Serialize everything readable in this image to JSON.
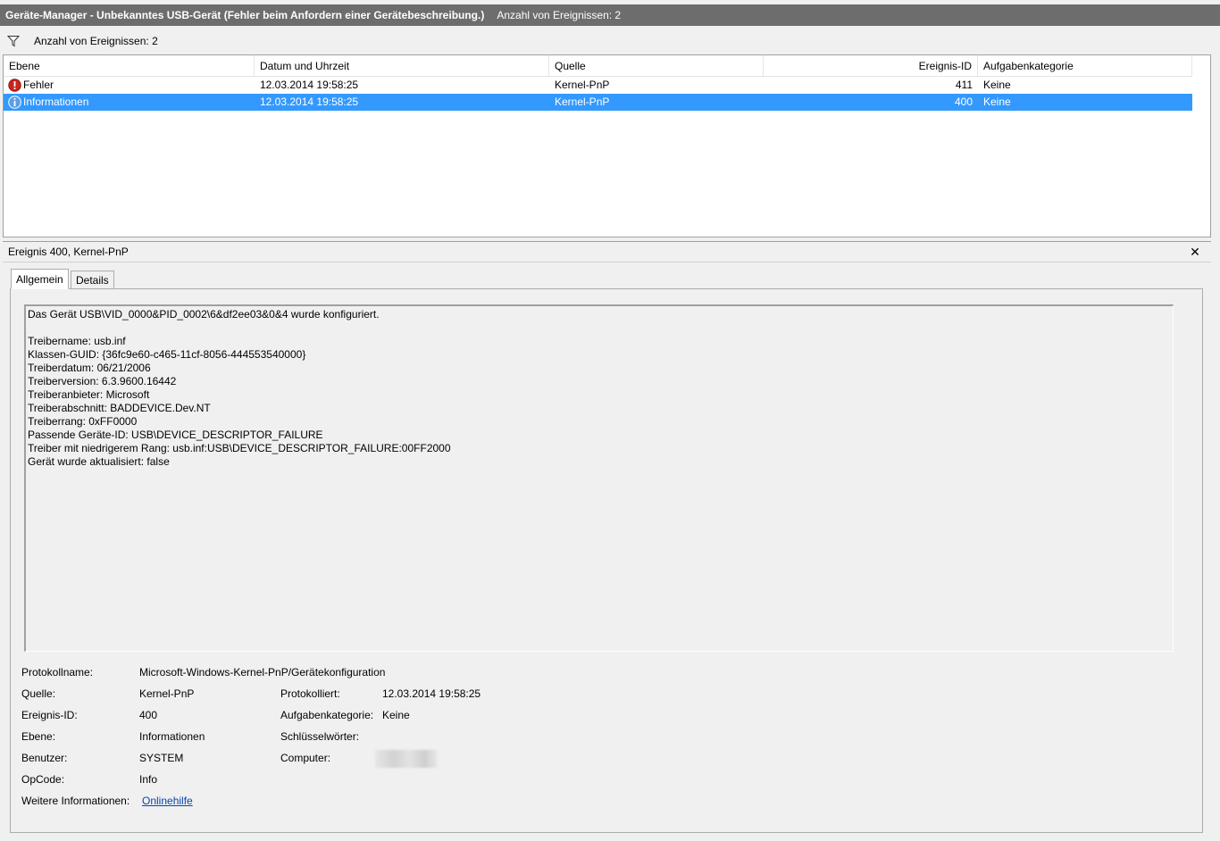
{
  "window": {
    "title": "Geräte-Manager - Unbekanntes USB-Gerät (Fehler beim Anfordern einer Gerätebeschreibung.)",
    "event_count": "Anzahl von Ereignissen: 2"
  },
  "filter_bar": {
    "text": "Anzahl von Ereignissen: 2"
  },
  "grid": {
    "columns": [
      "Ebene",
      "Datum und Uhrzeit",
      "Quelle",
      "Ereignis-ID",
      "Aufgabenkategorie"
    ],
    "rows": [
      {
        "level": "Fehler",
        "level_icon": "error-icon",
        "datetime": "12.03.2014 19:58:25",
        "source": "Kernel-PnP",
        "event_id": "411",
        "category": "Keine",
        "selected": false
      },
      {
        "level": "Informationen",
        "level_icon": "info-icon",
        "datetime": "12.03.2014 19:58:25",
        "source": "Kernel-PnP",
        "event_id": "400",
        "category": "Keine",
        "selected": true
      }
    ]
  },
  "detail": {
    "header": "Ereignis 400, Kernel-PnP",
    "close_icon": "close-icon",
    "tabs": [
      "Allgemein",
      "Details"
    ],
    "active_tab": "Allgemein",
    "description_lines": [
      "Das Gerät USB\\VID_0000&PID_0002\\6&df2ee03&0&4 wurde konfiguriert.",
      "",
      "Treibername: usb.inf",
      "Klassen-GUID: {36fc9e60-c465-11cf-8056-444553540000}",
      "Treiberdatum: 06/21/2006",
      "Treiberversion: 6.3.9600.16442",
      "Treiberanbieter: Microsoft",
      "Treiberabschnitt: BADDEVICE.Dev.NT",
      "Treiberrang: 0xFF0000",
      "Passende Geräte-ID: USB\\DEVICE_DESCRIPTOR_FAILURE",
      "Treiber mit niedrigerem Rang: usb.inf:USB\\DEVICE_DESCRIPTOR_FAILURE:00FF2000",
      "Gerät wurde aktualisiert: false"
    ],
    "props": {
      "log_name_label": "Protokollname:",
      "log_name": "Microsoft-Windows-Kernel-PnP/Gerätekonfiguration",
      "source_label": "Quelle:",
      "source": "Kernel-PnP",
      "logged_label": "Protokolliert:",
      "logged": "12.03.2014 19:58:25",
      "event_id_label": "Ereignis-ID:",
      "event_id": "400",
      "task_label": "Aufgabenkategorie:",
      "task": "Keine",
      "level_label": "Ebene:",
      "level": "Informationen",
      "keywords_label": "Schlüsselwörter:",
      "user_label": "Benutzer:",
      "user": "SYSTEM",
      "computer_label": "Computer:",
      "opcode_label": "OpCode:",
      "opcode": "Info",
      "more_info_label": "Weitere Informationen:",
      "more_info_link": "Onlinehilfe"
    }
  },
  "colors": {
    "titlebar": "#6d6d6d",
    "selection": "#3399ff",
    "link": "#0645ad"
  }
}
